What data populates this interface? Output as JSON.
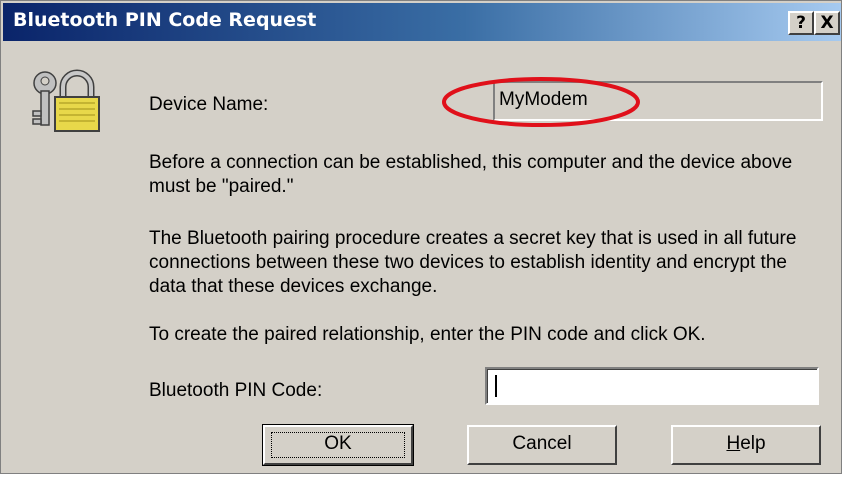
{
  "window": {
    "title": "Bluetooth PIN Code Request",
    "help_glyph": "?",
    "close_glyph": "X"
  },
  "icon": {
    "name": "lock-keys-icon",
    "accent": "#e8d84a"
  },
  "device": {
    "label": "Device Name:",
    "value": "MyModem",
    "highlight_color": "#e0101a"
  },
  "body": {
    "para1": "Before a connection can be established, this computer and the device above must be \"paired.\"",
    "para2": "The Bluetooth pairing procedure creates a secret key that is used in all future connections between these two devices to establish identity and encrypt the data that these devices exchange.",
    "para3": "To create the paired relationship, enter the PIN code and click OK."
  },
  "pin": {
    "label": "Bluetooth PIN Code:",
    "value": ""
  },
  "buttons": {
    "ok": "OK",
    "cancel": "Cancel",
    "help_mnemonic": "H",
    "help_rest": "elp"
  }
}
